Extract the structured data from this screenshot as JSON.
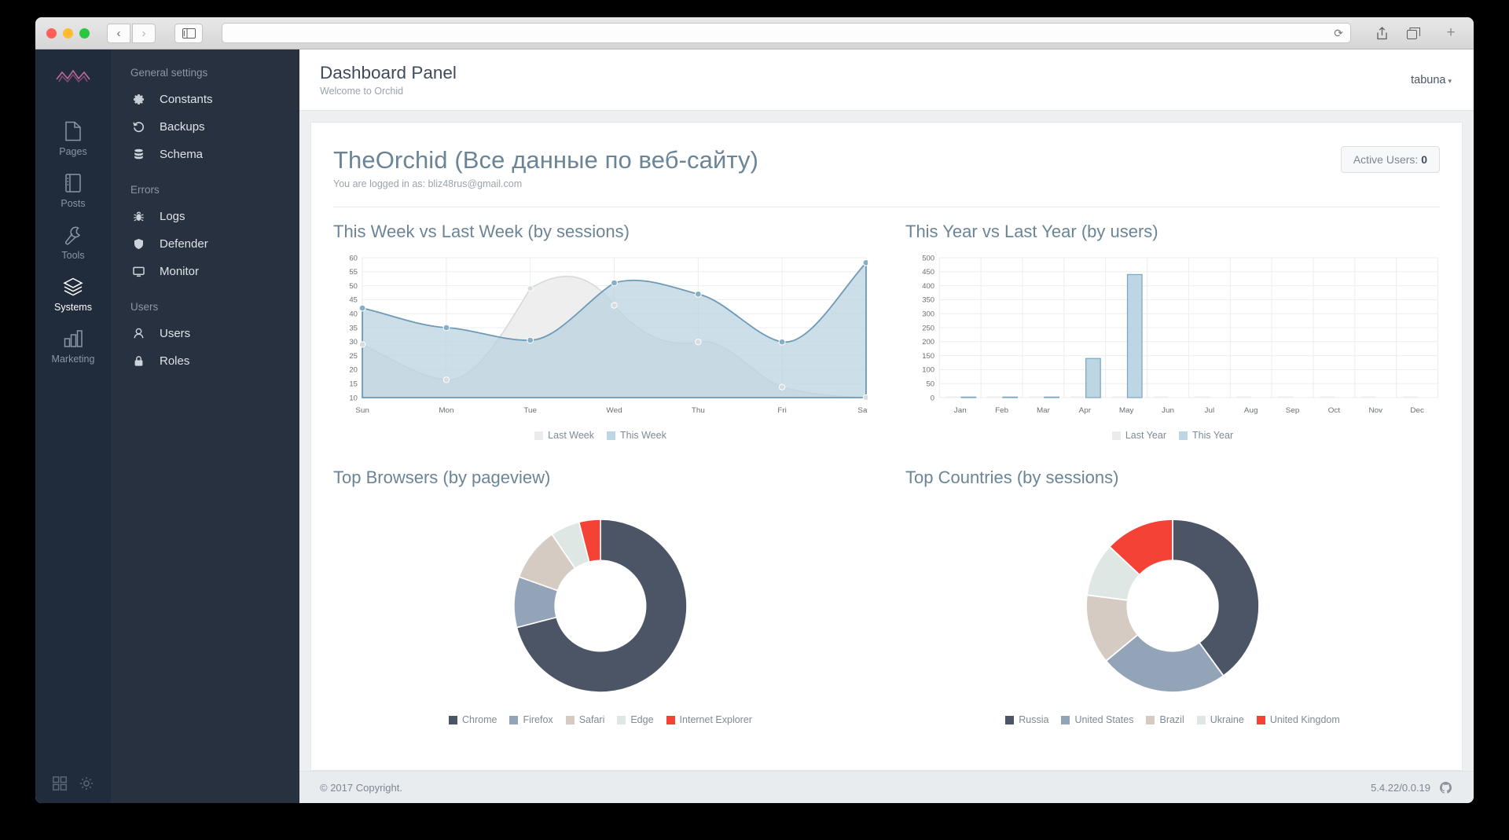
{
  "browser": {
    "traffic_lights": [
      "close",
      "minimize",
      "maximize"
    ],
    "back_label": "‹",
    "forward_label": "›",
    "url_value": "",
    "reload_icon": "reload-icon",
    "share_icon": "share-icon",
    "tabs_icon": "tabs-icon",
    "newtab_label": "+"
  },
  "iconbar": {
    "logo": "orchid-logo",
    "items": [
      {
        "label": "Pages",
        "icon": "page-icon",
        "active": false
      },
      {
        "label": "Posts",
        "icon": "posts-icon",
        "active": false
      },
      {
        "label": "Tools",
        "icon": "wrench-icon",
        "active": false
      },
      {
        "label": "Systems",
        "icon": "layers-icon",
        "active": true
      },
      {
        "label": "Marketing",
        "icon": "bar-chart-icon",
        "active": false
      }
    ],
    "bottom": [
      {
        "icon": "grid-icon"
      },
      {
        "icon": "gear-icon"
      }
    ]
  },
  "menu": {
    "groups": [
      {
        "title": "General settings",
        "items": [
          {
            "label": "Constants",
            "icon": "gear-icon"
          },
          {
            "label": "Backups",
            "icon": "history-icon"
          },
          {
            "label": "Schema",
            "icon": "database-icon"
          }
        ]
      },
      {
        "title": "Errors",
        "items": [
          {
            "label": "Logs",
            "icon": "bug-icon"
          },
          {
            "label": "Defender",
            "icon": "shield-icon"
          },
          {
            "label": "Monitor",
            "icon": "monitor-icon"
          }
        ]
      },
      {
        "title": "Users",
        "items": [
          {
            "label": "Users",
            "icon": "user-icon"
          },
          {
            "label": "Roles",
            "icon": "lock-icon"
          }
        ]
      }
    ]
  },
  "topbar": {
    "title": "Dashboard Panel",
    "subtitle": "Welcome to Orchid",
    "user": "tabuna",
    "caret": "▾"
  },
  "main": {
    "brand_title": "TheOrchid (Все данные по веб-сайту)",
    "brand_sub": "You are logged in as: bliz48rus@gmail.com",
    "active_users_label": "Active Users:",
    "active_users_value": "0"
  },
  "footer": {
    "copyright": "© 2017 Copyright.",
    "version": "5.4.22/0.0.19",
    "github_icon": "github-icon"
  },
  "colors": {
    "dark_slate": "#4c5566",
    "blue_gray": "#93a3b8",
    "beige": "#d5cbc2",
    "mint": "#dfe7e5",
    "red": "#f44336",
    "area_this": "#b4cede",
    "area_last": "#ebebeb",
    "line_this": "#6e9ab5",
    "line_last": "#cfd3d4",
    "bar_fill": "#bcd6e4",
    "bar_stroke": "#7ba6bf"
  },
  "chart_data": [
    {
      "type": "area",
      "title": "This Week vs Last Week (by sessions)",
      "categories": [
        "Sun",
        "Mon",
        "Tue",
        "Wed",
        "Thu",
        "Fri",
        "Sat"
      ],
      "series": [
        {
          "name": "Last Week",
          "values": [
            29,
            17,
            49,
            43,
            35,
            16,
            10
          ]
        },
        {
          "name": "This Week",
          "values": [
            42,
            35,
            30.5,
            51,
            47,
            30.5,
            56
          ]
        }
      ],
      "ylim": [
        10,
        60
      ],
      "yticks": [
        10,
        15,
        20,
        25,
        30,
        35,
        40,
        45,
        50,
        55,
        60
      ],
      "xlabel": "",
      "ylabel": "",
      "grid": true,
      "legend_position": "bottom"
    },
    {
      "type": "bar",
      "title": "This Year vs Last Year (by users)",
      "categories": [
        "Jan",
        "Feb",
        "Mar",
        "Apr",
        "May",
        "Jun",
        "Jul",
        "Aug",
        "Sep",
        "Oct",
        "Nov",
        "Dec"
      ],
      "series": [
        {
          "name": "Last Year",
          "values": [
            0,
            0,
            0,
            0,
            0,
            0,
            0,
            0,
            0,
            0,
            0,
            0
          ]
        },
        {
          "name": "This Year",
          "values": [
            2,
            2,
            2,
            140,
            440,
            0,
            0,
            0,
            0,
            0,
            0,
            0
          ]
        }
      ],
      "ylim": [
        0,
        500
      ],
      "yticks": [
        0,
        50,
        100,
        150,
        200,
        250,
        300,
        350,
        400,
        450,
        500
      ],
      "xlabel": "",
      "ylabel": "",
      "grid": true,
      "legend_position": "bottom"
    },
    {
      "type": "pie",
      "title": "Top Browsers (by pageview)",
      "labels": [
        "Chrome",
        "Firefox",
        "Safari",
        "Edge",
        "Internet Explorer"
      ],
      "values": [
        71,
        9.5,
        10,
        5.5,
        4
      ],
      "colors": [
        "#4c5566",
        "#93a3b8",
        "#d5cbc2",
        "#dfe7e5",
        "#f44336"
      ],
      "legend_position": "bottom",
      "donut": true
    },
    {
      "type": "pie",
      "title": "Top Countries (by sessions)",
      "labels": [
        "Russia",
        "United States",
        "Brazil",
        "Ukraine",
        "United Kingdom"
      ],
      "values": [
        40,
        21,
        16,
        10,
        13
      ],
      "colors": [
        "#4c5566",
        "#93a3b8",
        "#d5cbc2",
        "#dfe7e5",
        "#f44336"
      ],
      "legend_position": "bottom",
      "donut": true
    }
  ]
}
